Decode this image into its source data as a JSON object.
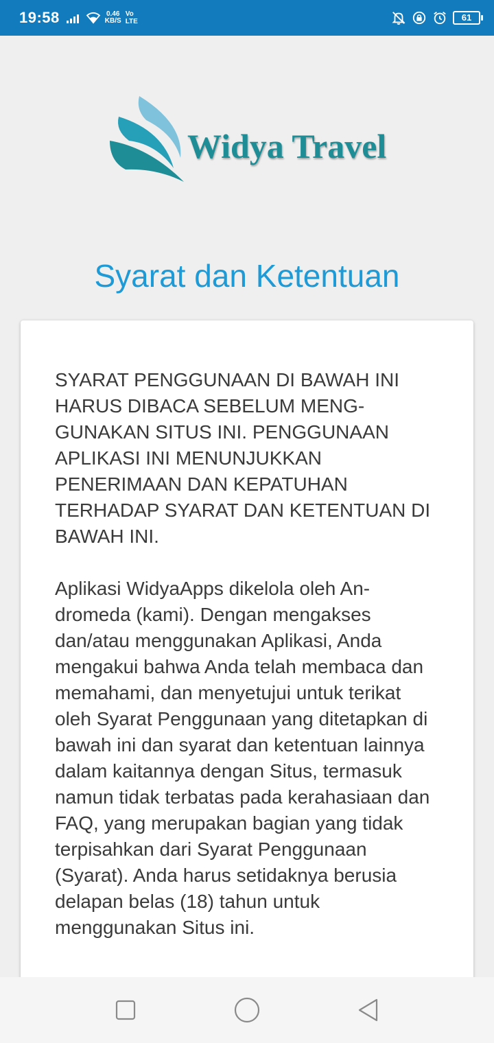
{
  "status_bar": {
    "time": "19:58",
    "net_speed_value": "0.46",
    "net_speed_unit": "KB/S",
    "volte_top": "Vo",
    "volte_bottom": "LTE",
    "battery": "61",
    "icons": [
      "signal-icon",
      "wifi-icon",
      "notifications-off-icon",
      "rotation-lock-icon",
      "alarm-icon",
      "battery-icon"
    ]
  },
  "logo": {
    "brand": "Widya Travel",
    "colors": {
      "teal": "#1f8d96",
      "light_blue": "#7fc2dc"
    }
  },
  "page": {
    "title": "Syarat dan Ketentuan"
  },
  "terms": {
    "intro": "SYARAT PENGGUNAAN DI BAWAH INI HARUS DIBACA SEBELUM MENG-GUNAKAN SITUS INI. PENGGUNAAN APLIKASI INI MENUNJUKKAN PENERIMAAN DAN KEPATUHAN TERHADAP SYARAT DAN KETENTUAN DI BAWAH INI.",
    "body": "Aplikasi WidyaApps dikelola oleh An-dromeda (kami). Dengan mengakses dan/atau menggunakan Aplikasi, Anda mengakui bahwa Anda telah membaca dan memahami, dan menyetujui untuk terikat oleh Syarat Penggunaan yang ditetapkan di bawah ini dan syarat dan ketentuan lainnya dalam kaitannya dengan Situs, termasuk namun tidak terbatas pada kerahasiaan dan FAQ, yang merupakan bagian yang tidak terpisahkan dari Syarat Penggunaan (Syarat). Anda harus setidaknya berusia delapan belas (18) tahun untuk menggunakan Situs ini."
  },
  "nav": {
    "items": [
      "recents-button",
      "home-button",
      "back-button"
    ]
  },
  "colors": {
    "status_bar": "#127bbd",
    "title": "#1e9ad6",
    "background": "#efefef",
    "card": "#ffffff"
  }
}
